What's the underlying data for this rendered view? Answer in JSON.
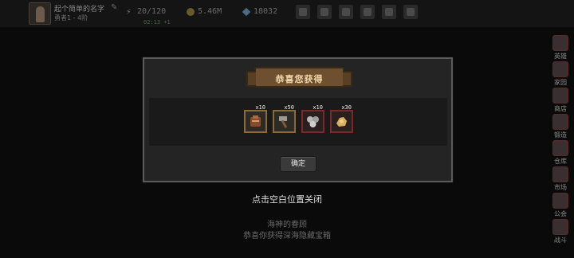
{
  "topbar": {
    "player_name": "起个简单的名字",
    "player_level": "勇者1 - 4阶",
    "stamina": "20/120",
    "stamina_regen": "02:13 +1",
    "gold": "5.46M",
    "gems": "18032",
    "icons": [
      "bag-icon",
      "mail-icon",
      "gamepad-icon",
      "settings-icon",
      "refresh-icon",
      "menu-icon"
    ]
  },
  "side_menu": {
    "items": [
      {
        "label": "英雄"
      },
      {
        "label": "家园"
      },
      {
        "label": "商店"
      },
      {
        "label": "锻造"
      },
      {
        "label": "仓库"
      },
      {
        "label": "市场"
      },
      {
        "label": "公会"
      },
      {
        "label": "战斗"
      }
    ]
  },
  "background": {
    "close_hint": "点击空白位置关闭",
    "hint_line1": "海神的眷顾",
    "hint_line2": "恭喜你获得深海隐藏宝箱"
  },
  "modal": {
    "title": "恭喜您获得",
    "items": [
      {
        "name": "leather-armor-icon",
        "qty": "x10",
        "frame": "gold"
      },
      {
        "name": "hammer-icon",
        "qty": "x50",
        "frame": "gold"
      },
      {
        "name": "ore-icon",
        "qty": "x10",
        "frame": "red"
      },
      {
        "name": "gold-nugget-icon",
        "qty": "x30",
        "frame": "red"
      }
    ],
    "confirm_label": "确定"
  }
}
